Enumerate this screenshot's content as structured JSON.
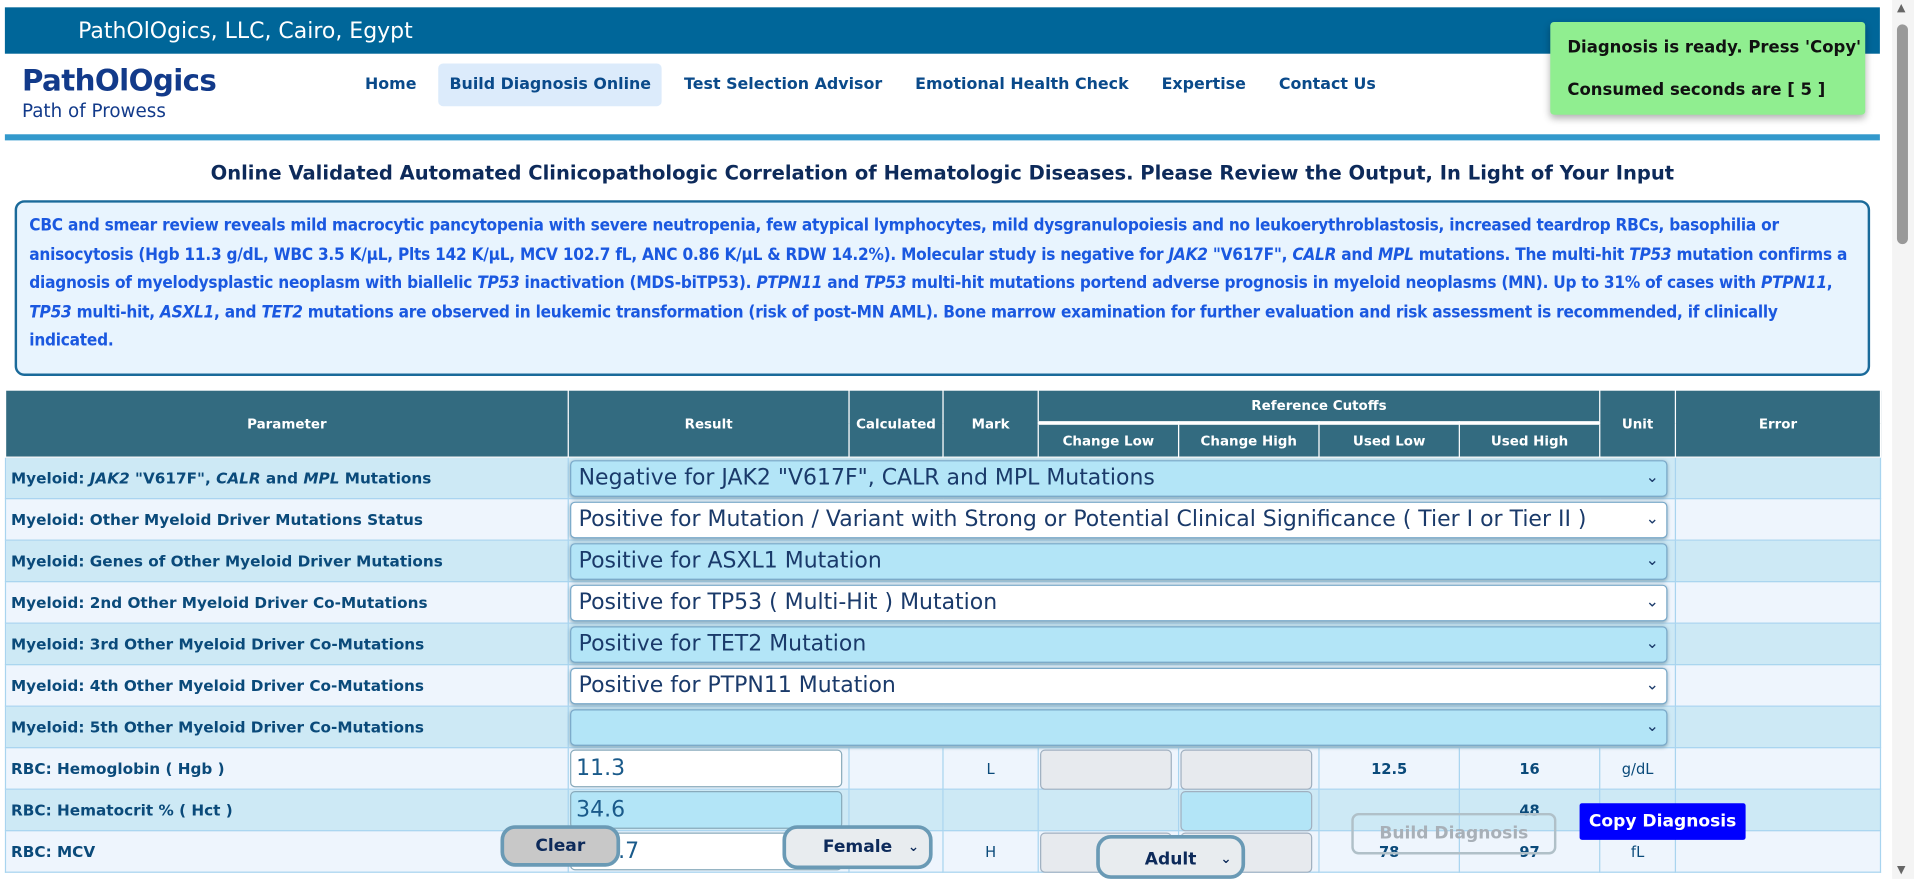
{
  "header": {
    "company": "PathOlOgics, LLC, Cairo, Egypt",
    "logo": "PathOlOgics",
    "tagline": "Path of Prowess"
  },
  "nav": [
    "Home",
    "Build Diagnosis Online",
    "Test Selection Advisor",
    "Emotional Health Check",
    "Expertise",
    "Contact Us"
  ],
  "nav_active": "Build Diagnosis Online",
  "toast": {
    "line1": "Diagnosis is ready. Press 'Copy'",
    "line2": "Consumed seconds are [ 5 ]",
    "color": "#90ee90"
  },
  "page_title": "Online Validated Automated Clinicopathologic Correlation of Hematologic Diseases. Please Review the Output, In Light of Your Input",
  "summary": [
    {
      "t": "CBC and smear review reveals mild macrocytic pancytopenia with severe neutropenia, few atypical lymphocytes, mild dysgranulopoiesis and no leukoerythroblastosis, increased teardrop RBCs, basophilia or anisocytosis (Hgb 11.3 g/dL, WBC 3.5 K/µL, Plts 142 K/µL, MCV 102.7 fL, ANC 0.86 K/µL & RDW 14.2%).  Molecular study is negative for "
    },
    {
      "t": "JAK2",
      "i": true
    },
    {
      "t": " \"V617F\", "
    },
    {
      "t": "CALR",
      "i": true
    },
    {
      "t": " and "
    },
    {
      "t": "MPL",
      "i": true
    },
    {
      "t": " mutations.  The multi-hit "
    },
    {
      "t": "TP53",
      "i": true
    },
    {
      "t": " mutation confirms a diagnosis of myelodysplastic neoplasm with biallelic "
    },
    {
      "t": "TP53",
      "i": true
    },
    {
      "t": " inactivation (MDS-biTP53).  "
    },
    {
      "t": "PTPN11",
      "i": true
    },
    {
      "t": " and "
    },
    {
      "t": "TP53",
      "i": true
    },
    {
      "t": " multi-hit mutations portend adverse prognosis in myeloid neoplasms (MN).  Up to 31% of cases with "
    },
    {
      "t": "PTPN11",
      "i": true
    },
    {
      "t": ", "
    },
    {
      "t": "TP53",
      "i": true
    },
    {
      "t": " multi-hit, "
    },
    {
      "t": "ASXL1",
      "i": true
    },
    {
      "t": ", and "
    },
    {
      "t": "TET2",
      "i": true
    },
    {
      "t": " mutations are observed in leukemic transformation (risk of post-MN AML).  Bone marrow examination for further evaluation and risk assessment is recommended, if clinically indicated."
    }
  ],
  "table": {
    "headers": {
      "parameter": "Parameter",
      "result": "Result",
      "calculated": "Calculated",
      "mark": "Mark",
      "reference": "Reference Cutoffs",
      "change_low": "Change Low",
      "change_high": "Change High",
      "used_low": "Used Low",
      "used_high": "Used High",
      "unit": "Unit",
      "error": "Error"
    },
    "select_rows": [
      {
        "label_html": [
          {
            "t": "Myeloid: "
          },
          {
            "t": "JAK2",
            "i": true
          },
          {
            "t": " \"V617F\", "
          },
          {
            "t": "CALR",
            "i": true
          },
          {
            "t": " and "
          },
          {
            "t": "MPL",
            "i": true
          },
          {
            "t": " Mutations"
          }
        ],
        "value": "Negative for JAK2 \"V617F\", CALR and MPL Mutations"
      },
      {
        "label_html": [
          {
            "t": "Myeloid: Other Myeloid Driver Mutations Status"
          }
        ],
        "value": "Positive for Mutation / Variant with Strong or Potential Clinical Significance ( Tier I or Tier II )"
      },
      {
        "label_html": [
          {
            "t": "Myeloid: Genes of Other Myeloid Driver Mutations"
          }
        ],
        "value": "Positive for ASXL1 Mutation"
      },
      {
        "label_html": [
          {
            "t": "Myeloid: 2nd Other Myeloid Driver Co-Mutations"
          }
        ],
        "value": "Positive for TP53 ( Multi-Hit ) Mutation"
      },
      {
        "label_html": [
          {
            "t": "Myeloid: 3rd Other Myeloid Driver Co-Mutations"
          }
        ],
        "value": "Positive for TET2 Mutation"
      },
      {
        "label_html": [
          {
            "t": "Myeloid: 4th Other Myeloid Driver Co-Mutations"
          }
        ],
        "value": "Positive for PTPN11 Mutation"
      },
      {
        "label_html": [
          {
            "t": "Myeloid: 5th Other Myeloid Driver Co-Mutations"
          }
        ],
        "value": ""
      }
    ],
    "numeric_rows": [
      {
        "label": "RBC: Hemoglobin ( Hgb )",
        "value": "11.3",
        "mark": "L",
        "used_low": "12.5",
        "used_high": "16",
        "unit": "g/dL"
      },
      {
        "label": "RBC: Hematocrit % ( Hct )",
        "value": "34.6",
        "mark": "",
        "used_low": "",
        "used_high": "48",
        "unit": ""
      },
      {
        "label": "RBC: MCV",
        "value": "102.7",
        "mark": "H",
        "used_low": "78",
        "used_high": "97",
        "unit": "fL"
      }
    ]
  },
  "controls": {
    "clear": "Clear",
    "sex": "Female",
    "age": "Adult",
    "build": "Build Diagnosis",
    "copy": "Copy Diagnosis",
    "copy_color": "#0000ff"
  }
}
